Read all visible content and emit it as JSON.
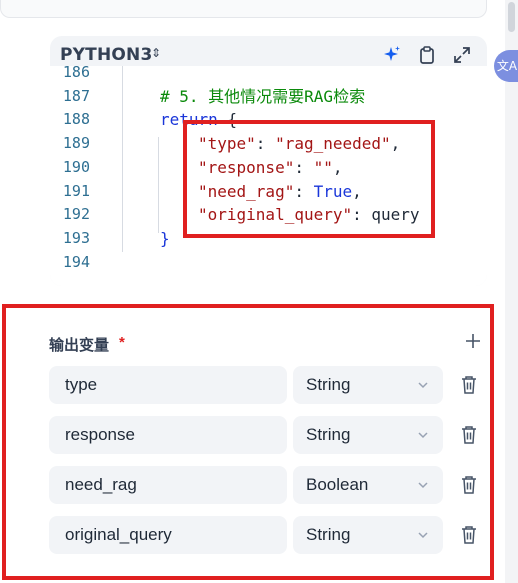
{
  "editor": {
    "language": "PYTHON3",
    "lines": [
      {
        "num": "186",
        "tokens": []
      },
      {
        "num": "187",
        "tokens": [
          {
            "cls": "tok-comment",
            "text": "# 5. 其他情况需要RAG检索"
          }
        ]
      },
      {
        "num": "188",
        "tokens": [
          {
            "cls": "tok-kw",
            "text": "return"
          },
          {
            "cls": "tok-plain",
            "text": " {"
          }
        ]
      },
      {
        "num": "189",
        "tokens": [
          {
            "cls": "tok-str",
            "text": "\"type\""
          },
          {
            "cls": "tok-plain",
            "text": ": "
          },
          {
            "cls": "tok-str",
            "text": "\"rag_needed\""
          },
          {
            "cls": "tok-plain",
            "text": ","
          }
        ]
      },
      {
        "num": "190",
        "tokens": [
          {
            "cls": "tok-str",
            "text": "\"response\""
          },
          {
            "cls": "tok-plain",
            "text": ": "
          },
          {
            "cls": "tok-str",
            "text": "\"\""
          },
          {
            "cls": "tok-plain",
            "text": ","
          }
        ]
      },
      {
        "num": "191",
        "tokens": [
          {
            "cls": "tok-str",
            "text": "\"need_rag\""
          },
          {
            "cls": "tok-plain",
            "text": ": "
          },
          {
            "cls": "tok-bool",
            "text": "True"
          },
          {
            "cls": "tok-plain",
            "text": ","
          }
        ]
      },
      {
        "num": "192",
        "tokens": [
          {
            "cls": "tok-str",
            "text": "\"original_query\""
          },
          {
            "cls": "tok-plain",
            "text": ": query"
          }
        ]
      },
      {
        "num": "193",
        "tokens": [
          {
            "cls": "tok-kw",
            "text": "}"
          }
        ]
      },
      {
        "num": "194",
        "tokens": []
      }
    ]
  },
  "output_vars": {
    "title": "输出变量",
    "required_mark": "*",
    "rows": [
      {
        "name": "type",
        "type": "String"
      },
      {
        "name": "response",
        "type": "String"
      },
      {
        "name": "need_rag",
        "type": "Boolean"
      },
      {
        "name": "original_query",
        "type": "String"
      }
    ]
  },
  "icons": {
    "lang_caret": "sort-caret-icon",
    "ai": "sparkle-icon",
    "copy": "clipboard-icon",
    "fullscreen": "expand-icon",
    "add": "plus-icon",
    "delete": "trash-icon",
    "dropdown": "chevron-down-icon",
    "translate": "translate-icon"
  },
  "colors": {
    "highlight_border": "#e02020",
    "accent_blue": "#155eef",
    "field_bg": "#f2f4f7"
  }
}
